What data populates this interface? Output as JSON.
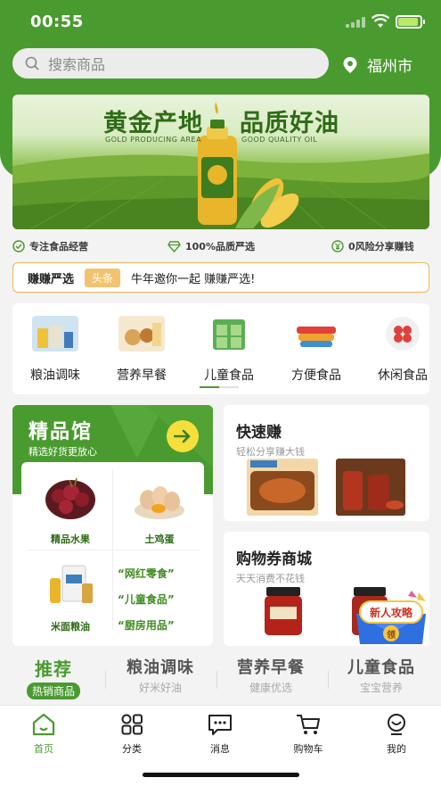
{
  "status": {
    "time": "00:55"
  },
  "search": {
    "placeholder": "搜索商品"
  },
  "location": {
    "city": "福州市"
  },
  "banner": {
    "title_left": "黄金产地",
    "title_right": "品质好油",
    "sub_left": "GOLD PRODUCING AREA",
    "sub_right": "GOOD QUALITY OIL"
  },
  "features": [
    {
      "label": "专注食品经营",
      "icon": "check-circle-icon"
    },
    {
      "label": "100%品质严选",
      "icon": "diamond-icon"
    },
    {
      "label": "0风险分享赚钱",
      "icon": "yen-circle-icon"
    }
  ],
  "notice": {
    "title": "赚赚严选",
    "tag": "头条",
    "message": "牛年邀你一起 赚赚严选!"
  },
  "categories": [
    {
      "label": "粮油调味"
    },
    {
      "label": "营养早餐"
    },
    {
      "label": "儿童食品"
    },
    {
      "label": "方便食品"
    },
    {
      "label": "休闲食品"
    }
  ],
  "premium": {
    "title": "精品馆",
    "subtitle": "精选好货更放心",
    "items": [
      {
        "label": "精品水果"
      },
      {
        "label": "土鸡蛋"
      },
      {
        "label": "米面粮油"
      }
    ],
    "quotes": [
      "“网红零食”",
      "“儿童食品”",
      "“厨房用品”"
    ]
  },
  "quick_earn": {
    "title": "快速赚",
    "subtitle": "轻松分享赚大钱"
  },
  "coupon_mall": {
    "title": "购物券商城",
    "subtitle": "天天消费不花钱"
  },
  "gift": {
    "label": "新人攻略",
    "button": "领"
  },
  "feed_tabs": [
    {
      "main": "推荐",
      "sub": "热销商品"
    },
    {
      "main": "粮油调味",
      "sub": "好米好油"
    },
    {
      "main": "营养早餐",
      "sub": "健康优选"
    },
    {
      "main": "儿童食品",
      "sub": "宝宝营养"
    }
  ],
  "nav": [
    {
      "label": "首页",
      "icon": "home-icon"
    },
    {
      "label": "分类",
      "icon": "category-grid-icon"
    },
    {
      "label": "消息",
      "icon": "message-icon"
    },
    {
      "label": "购物车",
      "icon": "cart-icon"
    },
    {
      "label": "我的",
      "icon": "profile-icon"
    }
  ],
  "colors": {
    "brand_green": "#4a9b2f",
    "notice_border": "#f0b45a",
    "arrow_yellow": "#f6df3b"
  }
}
